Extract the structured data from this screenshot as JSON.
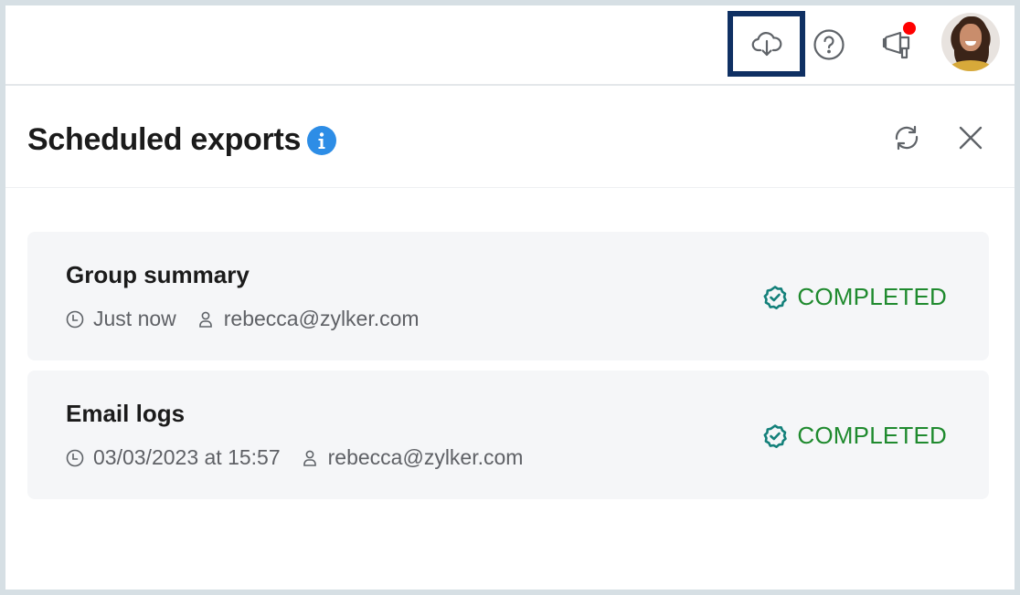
{
  "topbar": {
    "icons": [
      {
        "name": "cloud-download-icon",
        "highlighted": true
      },
      {
        "name": "help-icon"
      },
      {
        "name": "megaphone-icon",
        "has_notification": true
      },
      {
        "name": "avatar"
      }
    ],
    "highlight_color": "#0f3063",
    "notification_color": "#ff0000"
  },
  "panel": {
    "title": "Scheduled exports",
    "info_icon": "info-icon",
    "info_color": "#2d8de6",
    "actions": [
      {
        "name": "refresh-icon"
      },
      {
        "name": "close-icon"
      }
    ]
  },
  "exports": [
    {
      "title": "Group summary",
      "time": "Just now",
      "user": "rebecca@zylker.com",
      "status": "COMPLETED"
    },
    {
      "title": "Email logs",
      "time": "03/03/2023 at 15:57",
      "user": "rebecca@zylker.com",
      "status": "COMPLETED"
    }
  ],
  "colors": {
    "status_text": "#1f8a2e",
    "status_icon": "#13807a",
    "card_bg": "#f5f6f8",
    "frame_border": "#d6dfe4"
  }
}
